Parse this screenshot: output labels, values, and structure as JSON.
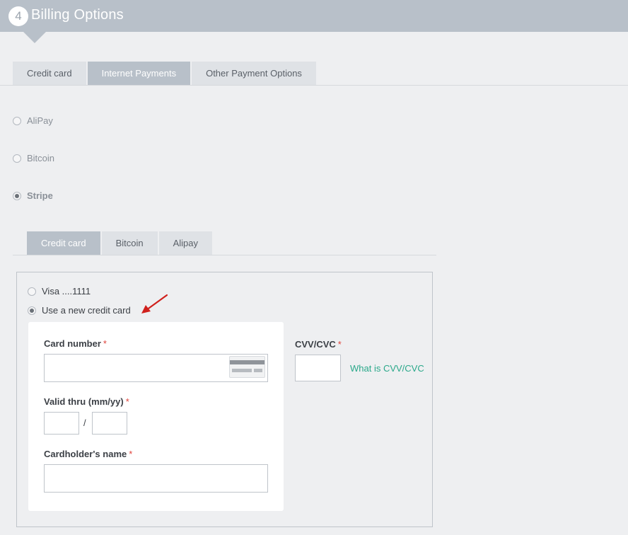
{
  "header": {
    "step_number": "4",
    "title": "Billing Options"
  },
  "top_tabs": [
    {
      "label": "Credit card",
      "active": false
    },
    {
      "label": "Internet Payments",
      "active": true
    },
    {
      "label": "Other Payment Options",
      "active": false
    }
  ],
  "payment_methods": [
    {
      "label": "AliPay",
      "checked": false
    },
    {
      "label": "Bitcoin",
      "checked": false
    },
    {
      "label": "Stripe",
      "checked": true
    }
  ],
  "stripe_tabs": [
    {
      "label": "Credit card",
      "active": true
    },
    {
      "label": "Bitcoin",
      "active": false
    },
    {
      "label": "Alipay",
      "active": false
    }
  ],
  "saved_cards": [
    {
      "label": "Visa ....1111",
      "checked": false
    },
    {
      "label": "Use a new credit card",
      "checked": true
    }
  ],
  "form": {
    "card_number_label": "Card number",
    "valid_thru_label": "Valid thru (mm/yy)",
    "date_separator": "/",
    "cardholder_label": "Cardholder's name",
    "cvv_label": "CVV/CVC",
    "cvv_link": "What is CVV/CVC",
    "required_mark": "*"
  },
  "colors": {
    "header_bg": "#b8c0c9",
    "link": "#2aa88a",
    "required": "#e0443c",
    "annotation_arrow": "#d0201c"
  }
}
